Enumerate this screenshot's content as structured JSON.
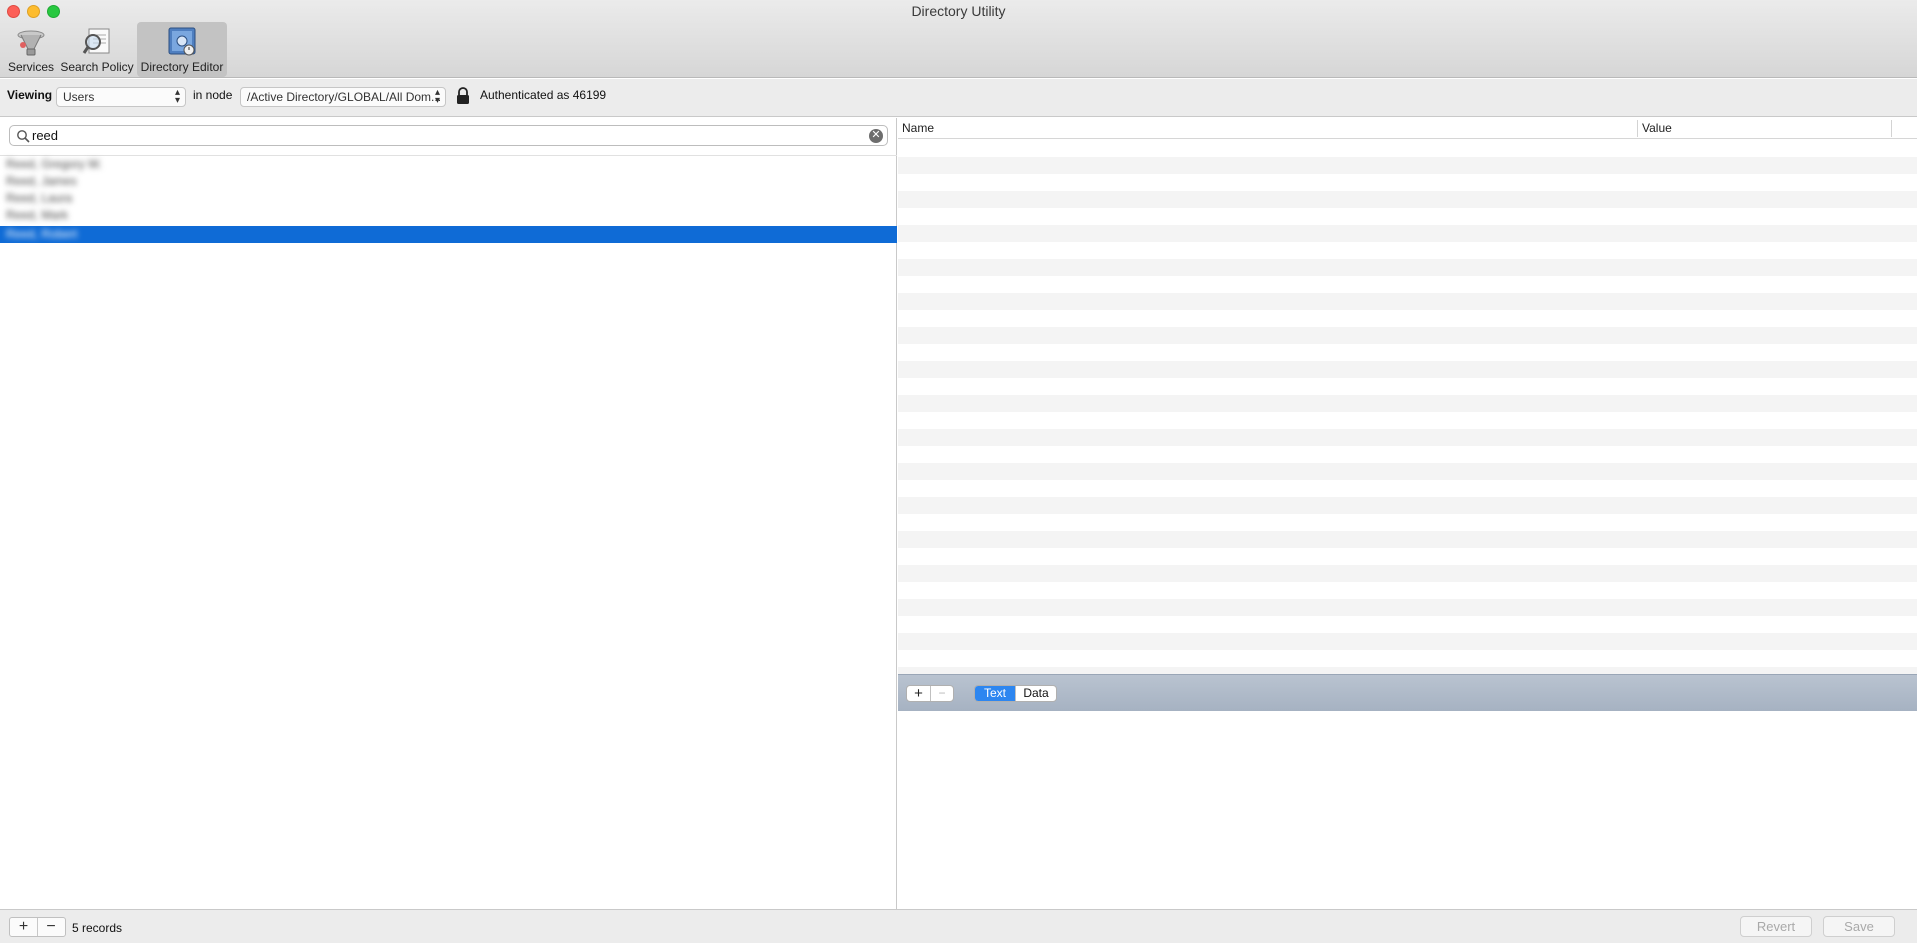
{
  "window": {
    "title": "Directory Utility"
  },
  "toolbar": {
    "items": [
      {
        "label": "Services",
        "icon": "services-icon"
      },
      {
        "label": "Search Policy",
        "icon": "search-policy-icon"
      },
      {
        "label": "Directory Editor",
        "icon": "directory-editor-icon",
        "active": true
      }
    ]
  },
  "filter": {
    "viewing_label": "Viewing",
    "viewing_value": "Users",
    "in_node_label": "in node",
    "node_value": "/Active Directory/GLOBAL/All Dom...",
    "auth_text": "Authenticated as 46199"
  },
  "search": {
    "value": "reed",
    "placeholder": ""
  },
  "records": [
    {
      "label": "Reed, Gregory W."
    },
    {
      "label": "Reed, James"
    },
    {
      "label": "Reed, Laura"
    },
    {
      "label": "Reed, Mark"
    },
    {
      "label": "Reed, Robert",
      "selected": true
    }
  ],
  "table": {
    "col_name": "Name",
    "col_value": "Value"
  },
  "edit": {
    "add": "+",
    "remove": "−",
    "text_mode": "Text",
    "data_mode": "Data",
    "selected_mode": "Text"
  },
  "footer": {
    "add": "+",
    "remove": "−",
    "record_count": "5 records",
    "revert": "Revert",
    "save": "Save"
  },
  "colors": {
    "selection": "#0f6bd6",
    "segment_on": "#2d86f0"
  }
}
